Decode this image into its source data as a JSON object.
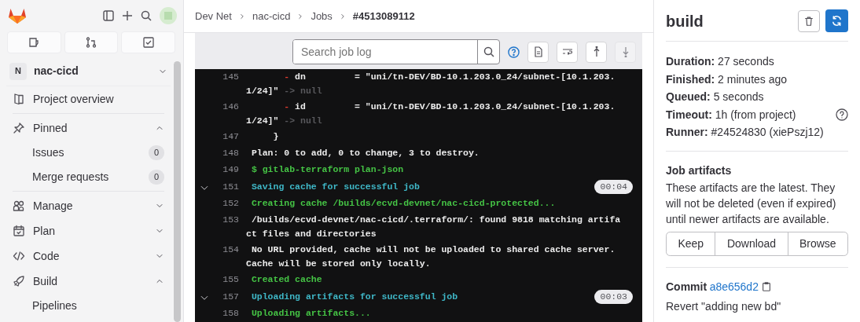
{
  "sidebar": {
    "project": {
      "initial": "N",
      "name": "nac-cicd",
      "expanded": false
    },
    "items": [
      {
        "label": "Project overview"
      },
      {
        "label": "Pinned",
        "expanded": true,
        "children": [
          {
            "label": "Issues",
            "count": "0"
          },
          {
            "label": "Merge requests",
            "count": "0"
          }
        ]
      },
      {
        "label": "Manage",
        "expanded": false
      },
      {
        "label": "Plan",
        "expanded": false
      },
      {
        "label": "Code",
        "expanded": false
      },
      {
        "label": "Build",
        "expanded": true,
        "children": [
          {
            "label": "Pipelines"
          }
        ]
      }
    ]
  },
  "breadcrumbs": [
    "Dev Net",
    "nac-cicd",
    "Jobs",
    "#4513089112"
  ],
  "log": {
    "search": {
      "placeholder": "Search job log"
    },
    "lines": [
      {
        "number": "145",
        "segments": [
          {
            "text": "       -",
            "color": "#dd3b2f"
          },
          {
            "text": " dn         = \"uni/tn-DEV/BD-10.1.203.0_24/subnet-[10.1.203.1/24]\"",
            "color": "#ececec"
          },
          {
            "text": " -> null",
            "color": "#58585c"
          }
        ]
      },
      {
        "number": "146",
        "segments": [
          {
            "text": "       -",
            "color": "#dd3b2f"
          },
          {
            "text": " id         = \"uni/tn-DEV/BD-10.1.203.0_24/subnet-[10.1.203.1/24]\"",
            "color": "#ececec"
          },
          {
            "text": " -> null",
            "color": "#58585c"
          }
        ]
      },
      {
        "number": "147",
        "segments": [
          {
            "text": "     }",
            "color": "#ececec"
          }
        ]
      },
      {
        "number": "148",
        "segments": [
          {
            "text": " Plan: 0 to add, 0 to change, 3 to destroy.",
            "color": "#ececec"
          }
        ]
      },
      {
        "number": "149",
        "segments": [
          {
            "text": " $ gitlab-terraform plan-json",
            "color": "#45c445"
          }
        ]
      },
      {
        "number": "151",
        "segments": [
          {
            "text": " Saving cache for successful job",
            "color": "#3fb8c8"
          }
        ],
        "section": {
          "expanded": true,
          "duration": "00:04"
        }
      },
      {
        "number": "152",
        "segments": [
          {
            "text": " Creating cache /builds/ecvd-devnet/nac-cicd-protected...",
            "color": "#45c445"
          }
        ]
      },
      {
        "number": "153",
        "segments": [
          {
            "text": " /builds/ecvd-devnet/nac-cicd/.terraform/: found 9818 matching artifact files and directories",
            "color": "#ececec"
          }
        ]
      },
      {
        "number": "154",
        "segments": [
          {
            "text": " No URL provided, cache will not be uploaded to shared cache server. Cache will be stored only locally.",
            "color": "#ececec"
          }
        ]
      },
      {
        "number": "155",
        "segments": [
          {
            "text": " Created cache",
            "color": "#45c445"
          }
        ]
      },
      {
        "number": "157",
        "segments": [
          {
            "text": " Uploading artifacts for successful job",
            "color": "#3fb8c8"
          }
        ],
        "section": {
          "expanded": true,
          "duration": "00:03"
        }
      },
      {
        "number": "158",
        "segments": [
          {
            "text": " Uploading artifacts...",
            "color": "#45c445"
          }
        ]
      }
    ]
  },
  "job": {
    "name": "build",
    "details": [
      {
        "label": "Duration:",
        "value": "27 seconds"
      },
      {
        "label": "Finished:",
        "value": "2 minutes ago"
      },
      {
        "label": "Queued:",
        "value": "5 seconds"
      },
      {
        "label": "Timeout:",
        "value": "1h (from project)",
        "help": true
      },
      {
        "label": "Runner:",
        "value": "#24524830 (xiePszj12)"
      }
    ],
    "artifacts": {
      "title": "Job artifacts",
      "description": "These artifacts are the latest. They will not be deleted (even if expired) until newer artifacts are available.",
      "buttons": [
        "Keep",
        "Download",
        "Browse"
      ]
    },
    "commit": {
      "label": "Commit",
      "sha": "a8e656d2",
      "message": "Revert \"adding new bd\""
    }
  }
}
